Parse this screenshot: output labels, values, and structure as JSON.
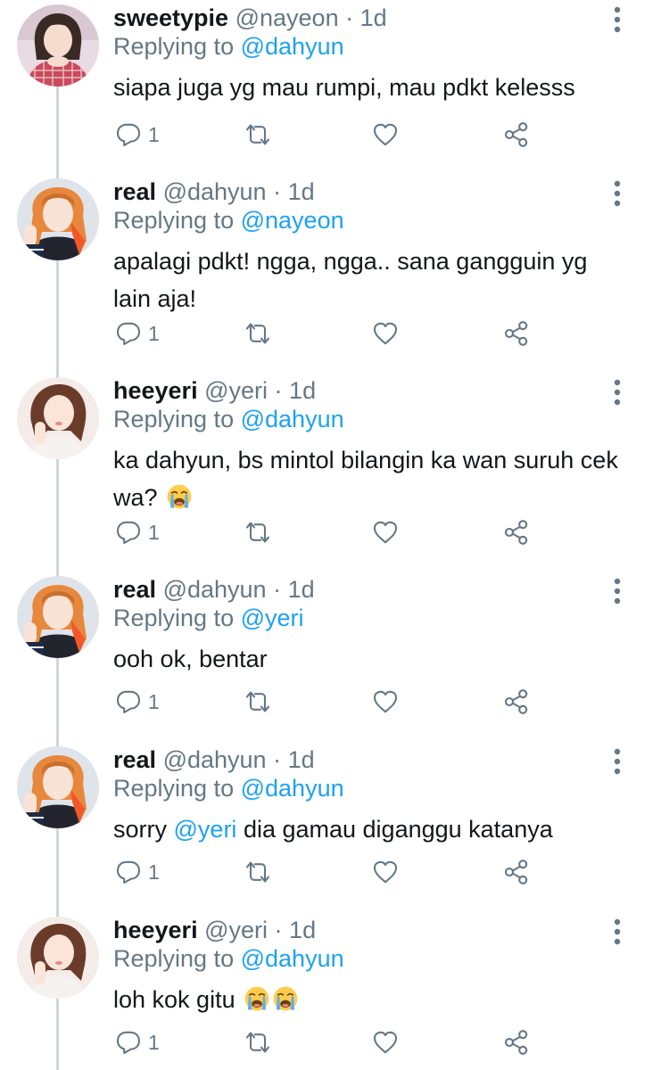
{
  "tweets": [
    {
      "name": "sweetypie",
      "handle": "@nayeon",
      "dot": "·",
      "time": "1d",
      "replying_prefix": "Replying to",
      "replying_to": "@dahyun",
      "text": "siapa juga yg mau rumpi, mau pdkt kelesss",
      "reply_count": "1"
    },
    {
      "name": "real",
      "handle": "@dahyun",
      "dot": "·",
      "time": "1d",
      "replying_prefix": "Replying to",
      "replying_to": "@nayeon",
      "text": "apalagi pdkt! ngga, ngga.. sana gangguin yg lain aja!",
      "reply_count": "1"
    },
    {
      "name": "heeyeri",
      "handle": "@yeri",
      "dot": "·",
      "time": "1d",
      "replying_prefix": "Replying to",
      "replying_to": "@dahyun",
      "text": "ka dahyun, bs mintol bilangin ka wan suruh cek wa?",
      "emoji": "loudly-crying-face",
      "reply_count": "1"
    },
    {
      "name": "real",
      "handle": "@dahyun",
      "dot": "·",
      "time": "1d",
      "replying_prefix": "Replying to",
      "replying_to": "@yeri",
      "text": "ooh ok, bentar",
      "reply_count": "1"
    },
    {
      "name": "real",
      "handle": "@dahyun",
      "dot": "·",
      "time": "1d",
      "replying_prefix": "Replying to",
      "replying_to": "@dahyun",
      "text_before": "sorry",
      "text_mention": "@yeri",
      "text_after": "dia gamau diganggu katanya",
      "reply_count": "1"
    },
    {
      "name": "heeyeri",
      "handle": "@yeri",
      "dot": "·",
      "time": "1d",
      "replying_prefix": "Replying to",
      "replying_to": "@dahyun",
      "text": "loh kok gitu",
      "emoji": "loudly-crying-face",
      "emoji_count": 2,
      "reply_count": "1"
    }
  ],
  "colors": {
    "link": "#1da1f2",
    "secondary_text": "#657786",
    "primary_text": "#14171a",
    "thread_line": "#ccd6dd"
  },
  "icons": {
    "reply": "reply-bubble-icon",
    "retweet": "retweet-icon",
    "like": "heart-icon",
    "share": "share-icon",
    "more": "more-vertical-icon"
  }
}
